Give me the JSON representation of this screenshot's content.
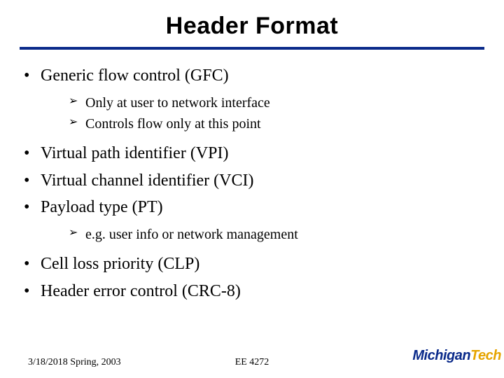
{
  "title": "Header Format",
  "bullets": {
    "b1": "Generic flow control (GFC)",
    "b1_sub": {
      "s1": "Only at user to network interface",
      "s2": "Controls flow only at this point"
    },
    "b2": "Virtual path identifier (VPI)",
    "b3": "Virtual channel identifier (VCI)",
    "b4": "Payload type (PT)",
    "b4_sub": {
      "s1": "e.g. user info or network management"
    },
    "b5": "Cell loss priority (CLP)",
    "b6": "Header error control (CRC-8)"
  },
  "footer": {
    "left": "3/18/2018 Spring, 2003",
    "center": "EE 4272"
  },
  "logo": {
    "part1": "Michigan",
    "part2": "Tech"
  }
}
